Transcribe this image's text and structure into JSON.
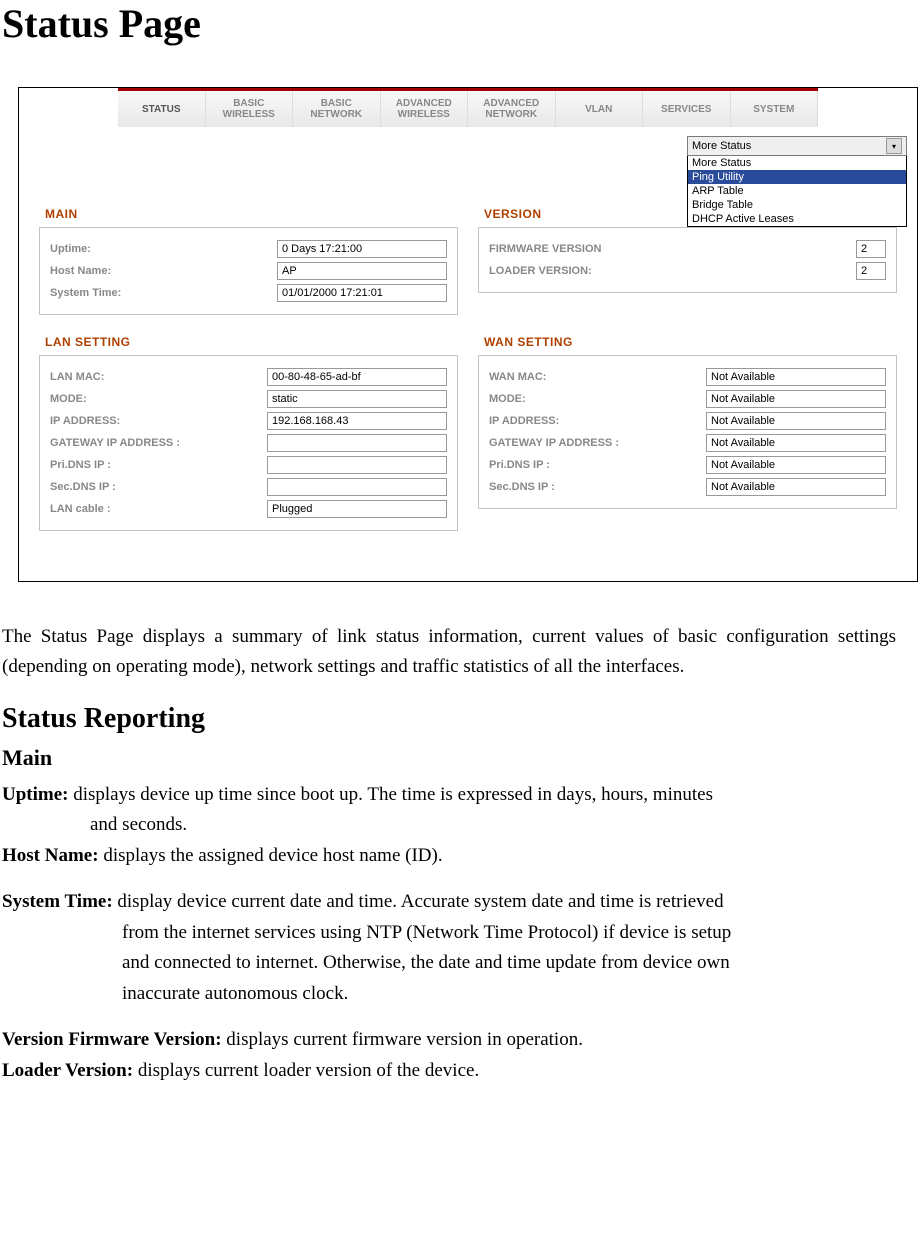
{
  "page_title": "Status Page",
  "nav_tabs": [
    "STATUS",
    "BASIC WIRELESS",
    "BASIC NETWORK",
    "ADVANCED WIRELESS",
    "ADVANCED NETWORK",
    "VLAN",
    "SERVICES",
    "SYSTEM"
  ],
  "dropdown": {
    "selected": "More Status",
    "options": [
      "More Status",
      "Ping Utility",
      "ARP Table",
      "Bridge Table",
      "DHCP Active Leases"
    ],
    "highlighted_index": 1
  },
  "panels": {
    "main": {
      "title": "MAIN",
      "uptime_label": "Uptime:",
      "uptime_value": "0 Days 17:21:00",
      "hostname_label": "Host Name:",
      "hostname_value": "AP",
      "systime_label": "System Time:",
      "systime_value": "01/01/2000 17:21:01"
    },
    "version": {
      "title": "VERSION",
      "fw_label": "FIRMWARE VERSION",
      "fw_value": "2",
      "loader_label": "LOADER VERSION:",
      "loader_value": "2"
    },
    "lan": {
      "title": "LAN SETTING",
      "mac_label": "LAN MAC:",
      "mac_value": "00-80-48-65-ad-bf",
      "mode_label": "MODE:",
      "mode_value": "static",
      "ip_label": "IP ADDRESS:",
      "ip_value": "192.168.168.43",
      "gw_label": "GATEWAY IP ADDRESS :",
      "gw_value": "",
      "pdns_label": "Pri.DNS IP :",
      "pdns_value": "",
      "sdns_label": "Sec.DNS IP :",
      "sdns_value": "",
      "cable_label": "LAN cable :",
      "cable_value": "Plugged"
    },
    "wan": {
      "title": "WAN SETTING",
      "mac_label": "WAN MAC:",
      "mac_value": "Not Available",
      "mode_label": "MODE:",
      "mode_value": "Not Available",
      "ip_label": "IP ADDRESS:",
      "ip_value": "Not Available",
      "gw_label": "GATEWAY IP ADDRESS :",
      "gw_value": "Not Available",
      "pdns_label": "Pri.DNS IP :",
      "pdns_value": "Not Available",
      "sdns_label": "Sec.DNS IP :",
      "sdns_value": "Not Available"
    }
  },
  "body_text": {
    "desc": "The Status Page displays a summary of link status information, current values of basic configuration settings (depending on operating mode), network settings and traffic statistics of all the interfaces.",
    "h2": "Status Reporting",
    "h3": "Main",
    "uptime_b": "Uptime:",
    "uptime_t1": " displays device up time since boot up. The time is expressed in days, hours, minutes",
    "uptime_t2": "and seconds.",
    "host_b": "Host Name:",
    "host_t": " displays the assigned device host name (ID).",
    "sys_b": "System Time:",
    "sys_t1": " display device current date and time. Accurate system date and time is retrieved",
    "sys_t2": "from the internet services using NTP (Network Time Protocol) if device is setup",
    "sys_t3": "and connected to internet. Otherwise, the date and time update from device own",
    "sys_t4": "inaccurate autonomous clock.",
    "ver_b": "Version Firmware Version:",
    "ver_t": " displays current firmware version in operation.",
    "ld_b": "Loader Version:",
    "ld_t": " displays current loader version of the device."
  }
}
